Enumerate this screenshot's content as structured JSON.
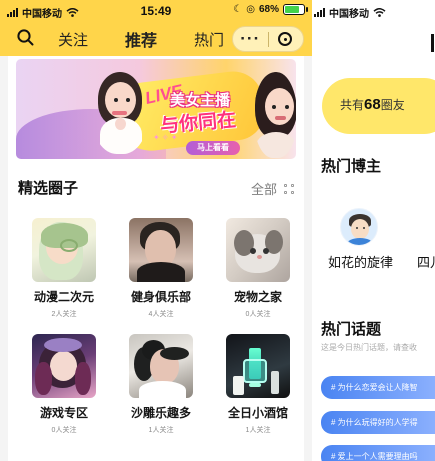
{
  "left_screen": {
    "status_bar": {
      "carrier": "中国移动",
      "time": "15:49",
      "battery_percent": "68%",
      "battery_level": 0.68,
      "icons": [
        "signal-icon",
        "wifi-icon",
        "moon-icon",
        "alarm-icon",
        "battery-icon"
      ]
    },
    "nav": {
      "tabs": [
        {
          "label": "关注"
        },
        {
          "label": "推荐"
        },
        {
          "label": "热门"
        }
      ],
      "active_tab": "推荐",
      "more_icon": "···"
    },
    "banner": {
      "live_badge": "LIVE",
      "title_line1": "美女主播",
      "title_line2": "与你同在",
      "button_label": "马上看看"
    },
    "featured_circles": {
      "title": "精选圈子",
      "all_label": "全部",
      "items": [
        {
          "name": "动漫二次元",
          "followers": "2人关注"
        },
        {
          "name": "健身俱乐部",
          "followers": "4人关注"
        },
        {
          "name": "宠物之家",
          "followers": "0人关注"
        },
        {
          "name": "游戏专区",
          "followers": "0人关注"
        },
        {
          "name": "沙雕乐趣多",
          "followers": "1人关注"
        },
        {
          "name": "全日小酒馆",
          "followers": "1人关注"
        }
      ]
    }
  },
  "right_screen": {
    "status_bar": {
      "carrier": "中国移动"
    },
    "friends_summary": {
      "prefix": "共有",
      "count": "68",
      "suffix": "圈友"
    },
    "hot_bloggers": {
      "title": "热门博主",
      "items": [
        {
          "name": "如花的旋律"
        },
        {
          "name": "四儿"
        }
      ]
    },
    "hot_topics": {
      "title": "热门话题",
      "subtitle": "这是今日热门话题，请查收",
      "items": [
        {
          "label": "# 为什么恋爱会让人降智"
        },
        {
          "label": "# 为什么玩得好的人学得"
        },
        {
          "label": "# 爱上一个人需要理由吗"
        }
      ]
    }
  },
  "colors": {
    "header_yellow": "#ffd54a",
    "friends_yellow": "#ffe76a",
    "topic_blue": "#4a84f2",
    "banner_pink": "#ff327d"
  }
}
